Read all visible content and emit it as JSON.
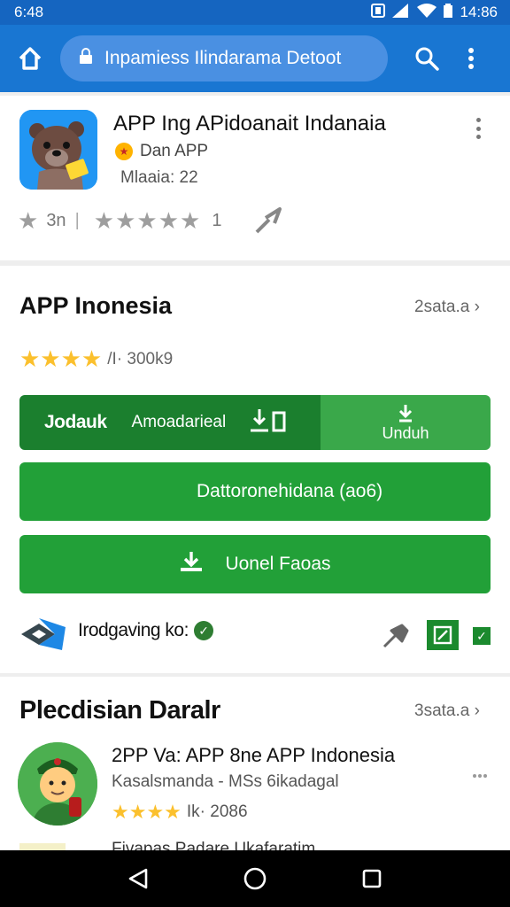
{
  "status_bar": {
    "time": "6:48",
    "right_time": "14:86"
  },
  "app_bar": {
    "url": "Inpamiess Ilindarama Detoot"
  },
  "app_card": {
    "title": "APP Ing APidoanait Indanaia",
    "developer": "Dan APP",
    "meta": "Mlaaia: 22",
    "rating_left": "3n",
    "rating_count": "1"
  },
  "detail_card": {
    "title": "APP Inonesia",
    "see_all": "2sata.a",
    "rating_text": "/I· 300k9",
    "split_button": {
      "left_a": "Jodauk",
      "left_b": "Amoadarieal",
      "right_label": "Unduh"
    },
    "button_a": "Dattoronehidana (ao6)",
    "button_b": "Uonel Faoas",
    "footer_text": "Irodgaving ko:"
  },
  "similar_card": {
    "title": "Plecdisian Daralr",
    "see_all": "3sata.a",
    "app": {
      "title": "2PP Va: APP 8ne APP Indonesia",
      "subtitle": "Kasalsmanda - MSs 6ikadagal",
      "rating_text": "Ik· 2086"
    },
    "peek_text": "Fivapas Padare Ukafaratim"
  },
  "colors": {
    "primary": "#1976d2",
    "status": "#1565c0",
    "green_dark": "#1b7f2e",
    "green": "#22a038",
    "star": "#fbc02d"
  }
}
